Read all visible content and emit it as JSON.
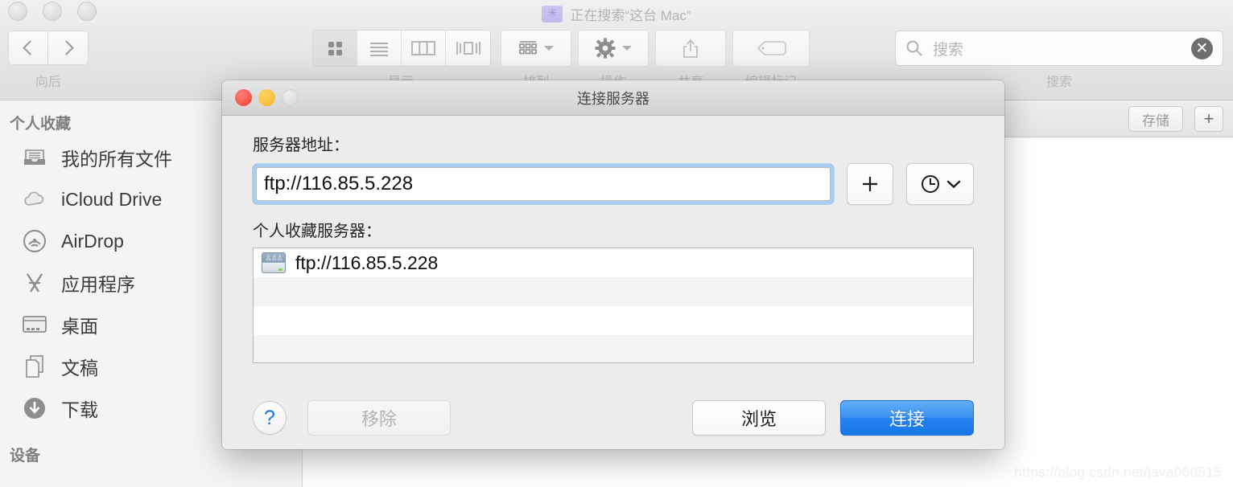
{
  "finder": {
    "window_title": "正在搜索“这台 Mac”",
    "title_icon": "smart-folder-icon",
    "nav": {
      "back_icon": "chevron-left-icon",
      "forward_icon": "chevron-right-icon",
      "caption": "向后"
    },
    "toolbar": {
      "view_caption": "显示",
      "arrange_caption": "排列",
      "action_caption": "操作",
      "share_caption": "共享",
      "tags_caption": "编辑标记",
      "search_caption": "搜索",
      "view_modes": [
        {
          "name": "icon-view",
          "icon": "grid-icon",
          "selected": true
        },
        {
          "name": "list-view",
          "icon": "list-icon",
          "selected": false
        },
        {
          "name": "column-view",
          "icon": "columns-icon",
          "selected": false
        },
        {
          "name": "coverflow-view",
          "icon": "coverflow-icon",
          "selected": false
        }
      ],
      "arrange_icon": "arrange-grid-icon",
      "action_icon": "gear-icon",
      "share_icon": "share-icon",
      "tags_icon": "tag-icon"
    },
    "search": {
      "placeholder": "搜索",
      "value": "",
      "icon": "search-icon",
      "clear_icon": "clear-circle-icon"
    },
    "criteria": {
      "save_label": "存储",
      "add_label": "+"
    },
    "sidebar": {
      "sections": [
        {
          "header": "个人收藏",
          "items": [
            {
              "label": "我的所有文件",
              "icon": "files-tray-icon"
            },
            {
              "label": "iCloud Drive",
              "icon": "cloud-icon"
            },
            {
              "label": "AirDrop",
              "icon": "airdrop-icon"
            },
            {
              "label": "应用程序",
              "icon": "applications-icon"
            },
            {
              "label": "桌面",
              "icon": "desktop-icon"
            },
            {
              "label": "文稿",
              "icon": "documents-icon"
            },
            {
              "label": "下载",
              "icon": "downloads-icon"
            }
          ]
        },
        {
          "header": "设备",
          "items": []
        }
      ]
    },
    "watermark": "https://blog.csdn.net/java060515"
  },
  "dialog": {
    "title": "连接服务器",
    "traffic": {
      "close": "close-button",
      "minimize": "minimize-button",
      "zoom": "zoom-button"
    },
    "address": {
      "label": "服务器地址：",
      "value": "ftp://116.85.5.228",
      "placeholder": "",
      "add_icon": "plus-icon",
      "history_icon": "clock-icon",
      "history_caret": "chevron-down-icon"
    },
    "favorites": {
      "label": "个人收藏服务器：",
      "items": [
        {
          "name": "ftp://116.85.5.228",
          "icon": "network-drive-icon"
        }
      ],
      "empty_rows": 3
    },
    "footer": {
      "help_label": "?",
      "remove_label": "移除",
      "remove_disabled": true,
      "browse_label": "浏览",
      "connect_label": "连接"
    }
  },
  "colors": {
    "accent_blue": "#2382ee",
    "focus_ring": "#a8cdf0",
    "help_blue": "#1177e8",
    "title_lavender": "#c0baea"
  }
}
